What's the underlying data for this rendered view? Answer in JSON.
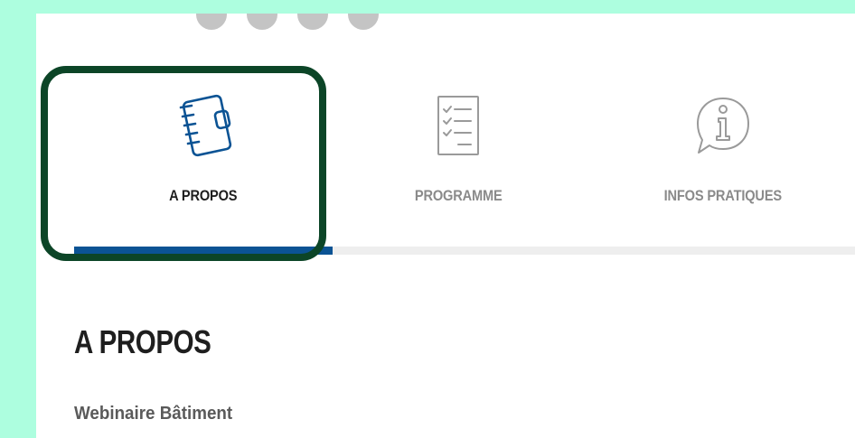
{
  "tabs": [
    {
      "label": "A PROPOS",
      "icon": "notebook-icon",
      "active": true
    },
    {
      "label": "PROGRAMME",
      "icon": "checklist-icon",
      "active": false
    },
    {
      "label": "INFOS PRATIQUES",
      "icon": "info-bubble-icon",
      "active": false
    }
  ],
  "section": {
    "title": "A PROPOS",
    "subtitle": "Webinaire Bâtiment"
  },
  "colors": {
    "background": "#adfedf",
    "accent": "#0b5394",
    "focus_ring": "#0c4527",
    "active_label": "#1e1e1e",
    "inactive_label": "#8a8a8a"
  }
}
